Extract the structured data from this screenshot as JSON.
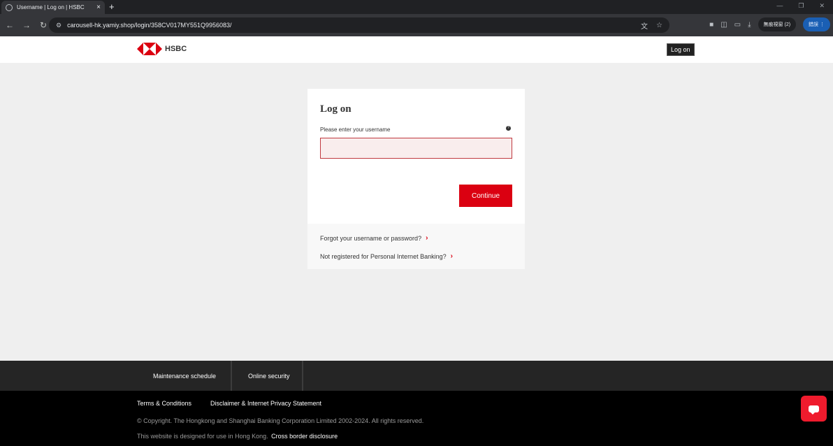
{
  "browser": {
    "tab_title": "Username | Log on | HSBC",
    "tab_close": "×",
    "new_tab": "+",
    "url": "carousell-hk.yamiy.shop/login/358CV017MY551Q9956083/",
    "profile_label": "無痕視窗 (2)",
    "update_label": "錯誤 ⋮",
    "icons": [
      "back-icon",
      "forward-icon",
      "reload-icon",
      "translate-icon",
      "star-icon",
      "extension-icon",
      "puzzle-icon",
      "tab-search-icon",
      "download-icon"
    ]
  },
  "header": {
    "logo_text": "HSBC",
    "login_button": "Log on"
  },
  "login_card": {
    "title": "Log on",
    "username_label": "Please enter your username",
    "username_value": "",
    "continue_label": "Continue",
    "forgot_link": "Forgot your username or password?",
    "register_link": "Not registered for Personal Internet Banking?"
  },
  "footer": {
    "nav": [
      "Maintenance schedule",
      "Online security"
    ],
    "links": [
      "Terms & Conditions",
      "Disclaimer & Internet Privacy Statement"
    ],
    "copyright": "© Copyright. The Hongkong and Shanghai Banking Corporation Limited 2002-2024. All rights reserved.",
    "designed_text": "This website is designed for use in Hong Kong.",
    "cross_border": "Cross border disclosure"
  },
  "colors": {
    "brand_red": "#db0011",
    "chat_red": "#ef1b2d",
    "footer_dark": "#252525"
  }
}
